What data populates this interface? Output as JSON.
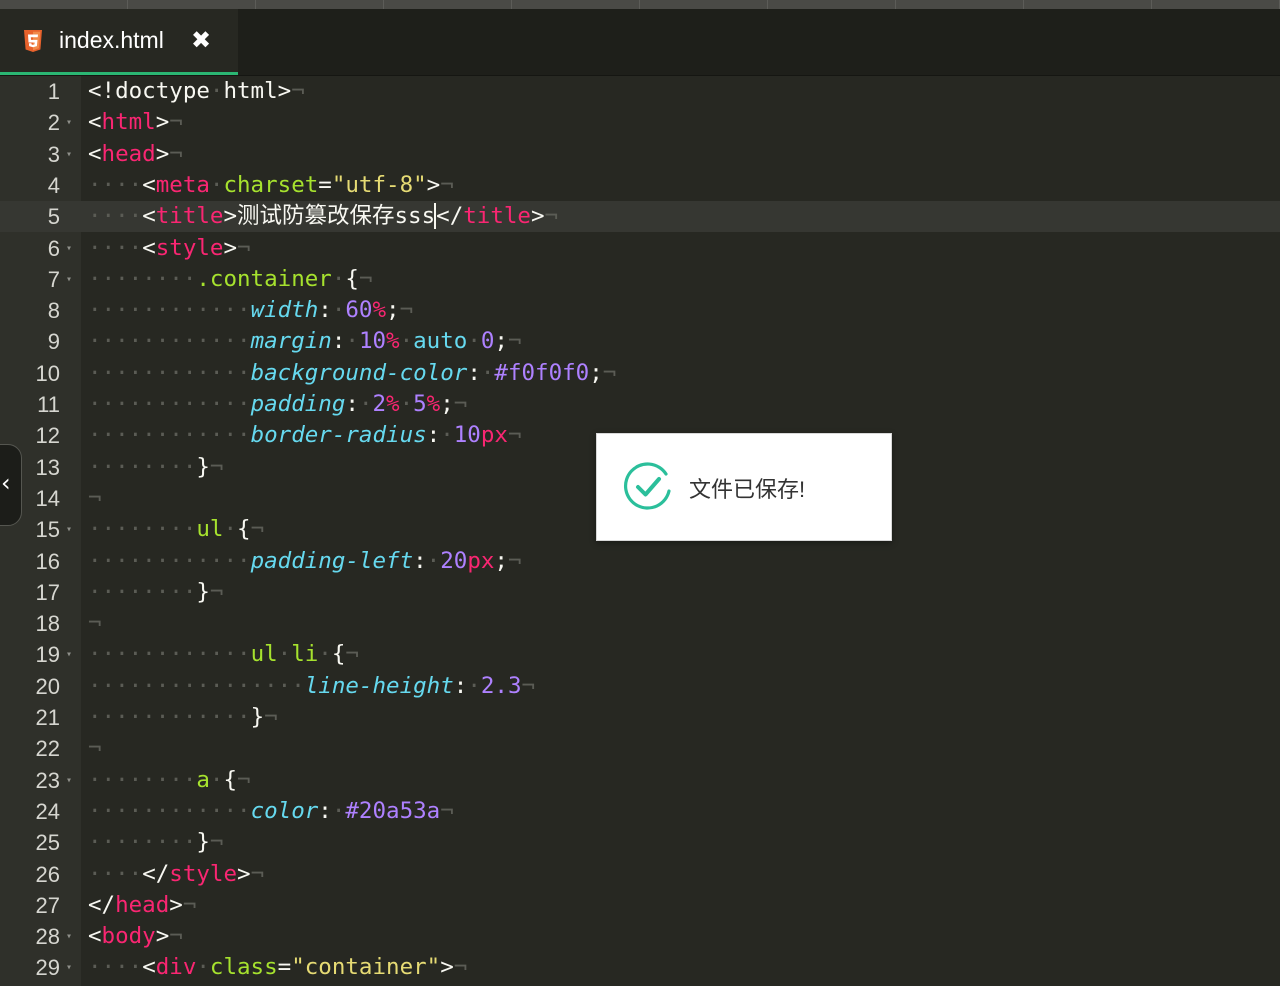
{
  "tab": {
    "filename": "index.html",
    "close_glyph": "✖",
    "icon": "html5-icon"
  },
  "toast": {
    "message": "文件已保存!",
    "icon": "check-circle-icon"
  },
  "colors": {
    "accent": "#2bb673",
    "background": "#272822",
    "tag": "#f92672",
    "attr": "#a6e22e",
    "string": "#e6db74",
    "property": "#66d9ef",
    "number": "#ae81ff"
  },
  "cursor_line": 5,
  "lines": [
    {
      "n": "1",
      "fold": false,
      "html": "&lt;!doctype<span class='ws'>·</span>html&gt;<span class='ws'>¬</span>"
    },
    {
      "n": "2",
      "fold": true,
      "html": "&lt;<span class='t'>html</span>&gt;<span class='ws'>¬</span>"
    },
    {
      "n": "3",
      "fold": true,
      "html": "&lt;<span class='t'>head</span>&gt;<span class='ws'>¬</span>"
    },
    {
      "n": "4",
      "fold": false,
      "html": "<span class='ws'>····</span>&lt;<span class='t'>meta</span><span class='ws'>·</span><span class='a'>charset</span>=<span class='s'>\"utf-8\"</span>&gt;<span class='ws'>¬</span>"
    },
    {
      "n": "5",
      "fold": false,
      "html": "<span class='ws'>····</span>&lt;<span class='t'>title</span>&gt;测试防篡改保存sss<span class='cursor'></span>&lt;/<span class='t'>title</span>&gt;<span class='ws'>¬</span>"
    },
    {
      "n": "6",
      "fold": true,
      "html": "<span class='ws'>····</span>&lt;<span class='t'>style</span>&gt;<span class='ws'>¬</span>"
    },
    {
      "n": "7",
      "fold": true,
      "html": "<span class='ws'>········</span><span class='a'>.container</span><span class='ws'>·</span>{<span class='ws'>¬</span>"
    },
    {
      "n": "8",
      "fold": false,
      "html": "<span class='ws'>············</span><span class='p'>width</span>:<span class='ws'>·</span><span class='n'>60</span><span class='u'>%</span>;<span class='ws'>¬</span>"
    },
    {
      "n": "9",
      "fold": false,
      "html": "<span class='ws'>············</span><span class='p'>margin</span>:<span class='ws'>·</span><span class='n'>10</span><span class='u'>%</span><span class='ws'>·</span><span class='k'>auto</span><span class='ws'>·</span><span class='n'>0</span>;<span class='ws'>¬</span>"
    },
    {
      "n": "10",
      "fold": false,
      "html": "<span class='ws'>············</span><span class='p'>background-color</span>:<span class='ws'>·</span><span class='n'>#f0f0f0</span>;<span class='ws'>¬</span>"
    },
    {
      "n": "11",
      "fold": false,
      "html": "<span class='ws'>············</span><span class='p'>padding</span>:<span class='ws'>·</span><span class='n'>2</span><span class='u'>%</span><span class='ws'>·</span><span class='n'>5</span><span class='u'>%</span>;<span class='ws'>¬</span>"
    },
    {
      "n": "12",
      "fold": false,
      "html": "<span class='ws'>············</span><span class='p'>border-radius</span>:<span class='ws'>·</span><span class='n'>10</span><span class='u'>px</span><span class='ws'>¬</span>"
    },
    {
      "n": "13",
      "fold": false,
      "html": "<span class='ws'>········</span>}<span class='ws'>¬</span>"
    },
    {
      "n": "14",
      "fold": false,
      "html": "<span class='ws'>¬</span>"
    },
    {
      "n": "15",
      "fold": true,
      "html": "<span class='ws'>········</span><span class='a'>ul</span><span class='ws'>·</span>{<span class='ws'>¬</span>"
    },
    {
      "n": "16",
      "fold": false,
      "html": "<span class='ws'>············</span><span class='p'>padding-left</span>:<span class='ws'>·</span><span class='n'>20</span><span class='u'>px</span>;<span class='ws'>¬</span>"
    },
    {
      "n": "17",
      "fold": false,
      "html": "<span class='ws'>········</span>}<span class='ws'>¬</span>"
    },
    {
      "n": "18",
      "fold": false,
      "html": "<span class='ws'>¬</span>"
    },
    {
      "n": "19",
      "fold": true,
      "html": "<span class='ws'>············</span><span class='a'>ul</span><span class='ws'>·</span><span class='a'>li</span><span class='ws'>·</span>{<span class='ws'>¬</span>"
    },
    {
      "n": "20",
      "fold": false,
      "html": "<span class='ws'>················</span><span class='p'>line-height</span>:<span class='ws'>·</span><span class='n'>2.3</span><span class='ws'>¬</span>"
    },
    {
      "n": "21",
      "fold": false,
      "html": "<span class='ws'>············</span>}<span class='ws'>¬</span>"
    },
    {
      "n": "22",
      "fold": false,
      "html": "<span class='ws'>¬</span>"
    },
    {
      "n": "23",
      "fold": true,
      "html": "<span class='ws'>········</span><span class='a'>a</span><span class='ws'>·</span>{<span class='ws'>¬</span>"
    },
    {
      "n": "24",
      "fold": false,
      "html": "<span class='ws'>············</span><span class='p'>color</span>:<span class='ws'>·</span><span class='n'>#20a53a</span><span class='ws'>¬</span>"
    },
    {
      "n": "25",
      "fold": false,
      "html": "<span class='ws'>········</span>}<span class='ws'>¬</span>"
    },
    {
      "n": "26",
      "fold": false,
      "html": "<span class='ws'>····</span>&lt;/<span class='t'>style</span>&gt;<span class='ws'>¬</span>"
    },
    {
      "n": "27",
      "fold": false,
      "html": "&lt;/<span class='t'>head</span>&gt;<span class='ws'>¬</span>"
    },
    {
      "n": "28",
      "fold": true,
      "html": "&lt;<span class='t'>body</span>&gt;<span class='ws'>¬</span>"
    },
    {
      "n": "29",
      "fold": true,
      "html": "<span class='ws'>····</span>&lt;<span class='t'>div</span><span class='ws'>·</span><span class='a'>class</span>=<span class='s'>\"container\"</span>&gt;<span class='ws'>¬</span>"
    }
  ]
}
